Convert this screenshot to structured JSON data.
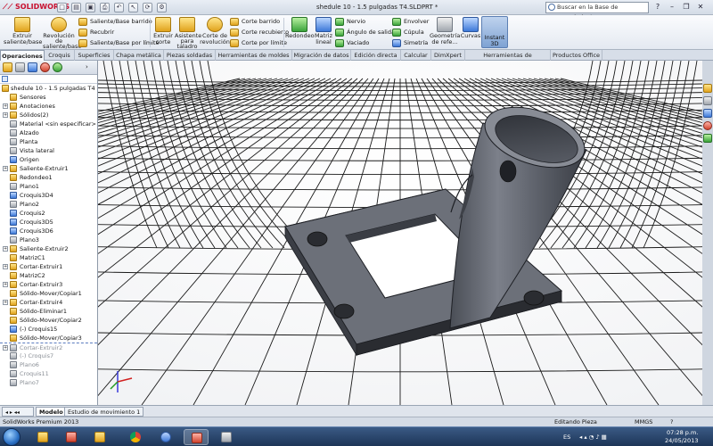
{
  "titlebar": {
    "app_name": "SOLIDWORKS",
    "document_title": "shedule 10 - 1.5 pulgadas T4.SLDPRT *",
    "search_placeholder": "Buscar en la Base de conocimiento",
    "window_buttons": [
      "?",
      "–",
      "❐",
      "✕"
    ]
  },
  "ribbon": {
    "extrude_boss": "Extruir\nsaliente/base",
    "revolve_boss": "Revolución\nde\nsaliente/base",
    "swept_boss": "Saliente/Base barrido",
    "lofted_boss": "Recubrir",
    "boundary_boss": "Saliente/Base por límite",
    "extrude_cut": "Extruir\ncorte",
    "hole_wizard": "Asistente\npara\ntaladro",
    "revolve_cut": "Corte de\nrevolución",
    "swept_cut": "Corte barrido",
    "lofted_cut": "Corte recubierto",
    "boundary_cut": "Corte por límite",
    "fillet": "Redondeo",
    "linear_pattern": "Matriz\nlineal",
    "rib": "Nervio",
    "draft": "Ángulo de salida",
    "shell": "Vaciado",
    "wrap": "Envolver",
    "dome": "Cúpula",
    "mirror": "Simetría",
    "ref_geometry": "Geometría\nde refe...",
    "curves": "Curvas",
    "instant3d": "Instant\n3D"
  },
  "command_tabs": [
    "Operaciones",
    "Croquis",
    "Superficies",
    "Chapa metálica",
    "Piezas soldadas",
    "Herramientas de moldes",
    "Migración de datos",
    "Edición directa",
    "Calcular",
    "DimXpert",
    "Herramientas de renderizado",
    "Productos Office"
  ],
  "feature_tree": {
    "root": "shedule 10 - 1.5 pulgadas T4  (Pr",
    "items": [
      {
        "label": "Sensores",
        "expand": false,
        "icon": "folder",
        "dim": false
      },
      {
        "label": "Anotaciones",
        "expand": true,
        "icon": "folder",
        "dim": false
      },
      {
        "label": "Sólidos(2)",
        "expand": true,
        "icon": "folder",
        "dim": false
      },
      {
        "label": "Material <sin especificar>",
        "expand": false,
        "icon": "material",
        "dim": false
      },
      {
        "label": "Alzado",
        "expand": false,
        "icon": "plane",
        "dim": false
      },
      {
        "label": "Planta",
        "expand": false,
        "icon": "plane",
        "dim": false
      },
      {
        "label": "Vista lateral",
        "expand": false,
        "icon": "plane",
        "dim": false
      },
      {
        "label": "Origen",
        "expand": false,
        "icon": "origin",
        "dim": false
      },
      {
        "label": "Saliente-Extruir1",
        "expand": true,
        "icon": "feature",
        "dim": false
      },
      {
        "label": "Redondeo1",
        "expand": false,
        "icon": "fillet",
        "dim": false
      },
      {
        "label": "Plano1",
        "expand": false,
        "icon": "plane",
        "dim": false
      },
      {
        "label": "Croquis3D4",
        "expand": false,
        "icon": "sketch",
        "dim": false
      },
      {
        "label": "Plano2",
        "expand": false,
        "icon": "plane",
        "dim": false
      },
      {
        "label": "Croquis2",
        "expand": false,
        "icon": "sketch",
        "dim": false
      },
      {
        "label": "Croquis3D5",
        "expand": false,
        "icon": "sketch",
        "dim": false
      },
      {
        "label": "Croquis3D6",
        "expand": false,
        "icon": "sketch",
        "dim": false
      },
      {
        "label": "Plano3",
        "expand": false,
        "icon": "plane",
        "dim": false
      },
      {
        "label": "Saliente-Extruir2",
        "expand": true,
        "icon": "feature",
        "dim": false
      },
      {
        "label": "MatrizC1",
        "expand": false,
        "icon": "feature",
        "dim": false
      },
      {
        "label": "Cortar-Extruir1",
        "expand": true,
        "icon": "feature",
        "dim": false
      },
      {
        "label": "MatrizC2",
        "expand": false,
        "icon": "feature",
        "dim": false
      },
      {
        "label": "Cortar-Extruir3",
        "expand": true,
        "icon": "feature",
        "dim": false
      },
      {
        "label": "Sólido-Mover/Copiar1",
        "expand": false,
        "icon": "move",
        "dim": false
      },
      {
        "label": "Cortar-Extruir4",
        "expand": true,
        "icon": "feature",
        "dim": false
      },
      {
        "label": "Sólido-Eliminar1",
        "expand": false,
        "icon": "move",
        "dim": false
      },
      {
        "label": "Sólido-Mover/Copiar2",
        "expand": false,
        "icon": "move",
        "dim": false
      },
      {
        "label": "(-) Croquis15",
        "expand": false,
        "icon": "sketch",
        "dim": false
      },
      {
        "label": "Sólido-Mover/Copiar3",
        "expand": false,
        "icon": "move",
        "dim": false
      },
      {
        "label": "Cortar-Extruir2",
        "expand": true,
        "icon": "feature",
        "dim": true
      },
      {
        "label": "(-) Croquis7",
        "expand": false,
        "icon": "sketch",
        "dim": true
      },
      {
        "label": "Plano6",
        "expand": false,
        "icon": "plane",
        "dim": true
      },
      {
        "label": "Croquis11",
        "expand": false,
        "icon": "sketch",
        "dim": true
      },
      {
        "label": "Plano7",
        "expand": false,
        "icon": "plane",
        "dim": true
      }
    ]
  },
  "bottom_tabs": [
    "Modelo",
    "Estudio de movimiento 1"
  ],
  "statusbar": {
    "product": "SolidWorks Premium 2013",
    "mode": "Editando Pieza",
    "units": "MMGS"
  },
  "taskbar": {
    "language": "ES",
    "time": "07:28 p.m.",
    "date": "24/05/2013"
  },
  "colors": {
    "part_face": "#6c7079",
    "part_dark": "#2e3138",
    "part_edge": "#1d1f24",
    "accent": "#c8102e"
  }
}
